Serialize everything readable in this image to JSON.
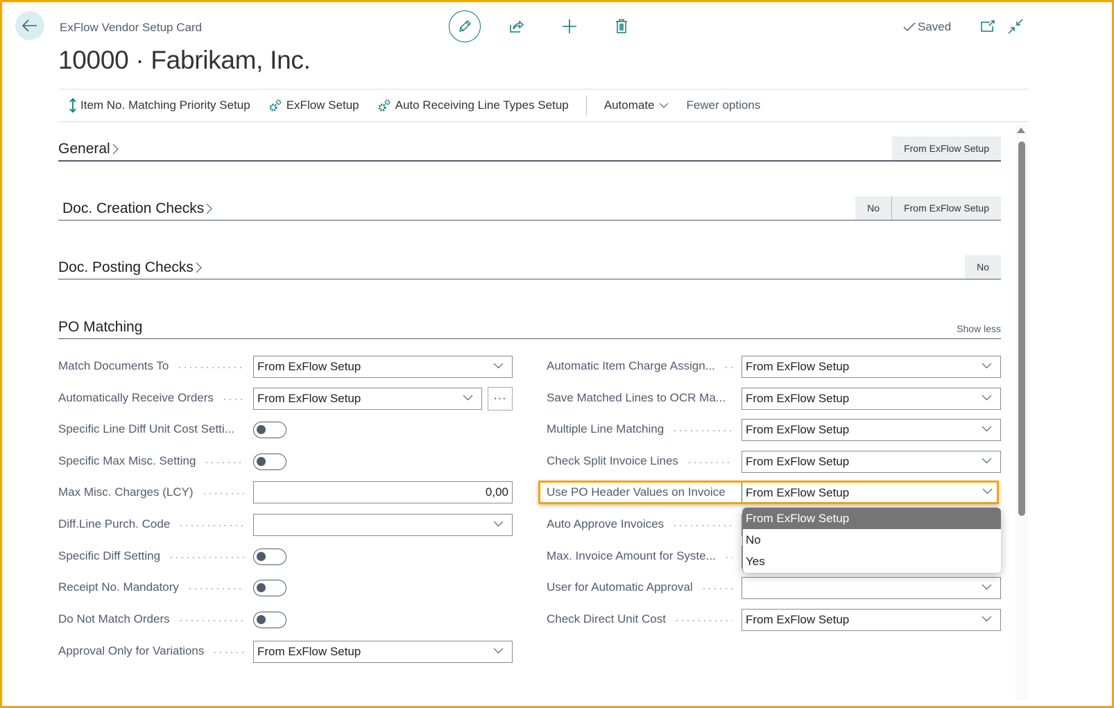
{
  "header": {
    "caption": "ExFlow Vendor Setup Card",
    "title": "10000 · Fabrikam, Inc.",
    "saved_label": "Saved",
    "icons": [
      "back-arrow-icon",
      "pencil-icon",
      "share-icon",
      "plus-icon",
      "trash-icon",
      "checkmark-icon",
      "open-new-window-icon",
      "collapse-icon"
    ]
  },
  "action_bar": {
    "actions": [
      {
        "label": "Item No. Matching Priority Setup",
        "icon": "sort-arrows-icon"
      },
      {
        "label": "ExFlow Setup",
        "icon": "gears-icon"
      },
      {
        "label": "Auto Receiving Line Types Setup",
        "icon": "gears-icon"
      }
    ],
    "automate_label": "Automate",
    "fewer_options_label": "Fewer options"
  },
  "fasttabs": {
    "general": {
      "title": "General",
      "summary": [
        "From ExFlow Setup"
      ]
    },
    "doc_creation": {
      "title": "Doc. Creation Checks",
      "summary": [
        "No",
        "From ExFlow Setup"
      ]
    },
    "doc_posting": {
      "title": "Doc. Posting Checks",
      "summary": [
        "No"
      ]
    },
    "po_matching": {
      "title": "PO Matching",
      "show_less_label": "Show less"
    }
  },
  "po_matching": {
    "left": [
      {
        "label": "Match Documents To",
        "type": "select",
        "value": "From ExFlow Setup"
      },
      {
        "label": "Automatically Receive Orders",
        "type": "select-lookup",
        "value": "From ExFlow Setup",
        "lookup_label": "···"
      },
      {
        "label": "Specific Line Diff Unit Cost Setti...",
        "type": "toggle",
        "value": false
      },
      {
        "label": "Specific Max Misc. Setting",
        "type": "toggle",
        "value": false
      },
      {
        "label": "Max Misc. Charges (LCY)",
        "type": "number",
        "value": "0,00"
      },
      {
        "label": "Diff.Line Purch. Code",
        "type": "select",
        "value": ""
      },
      {
        "label": "Specific Diff Setting",
        "type": "toggle",
        "value": false
      },
      {
        "label": "Receipt No. Mandatory",
        "type": "toggle",
        "value": false
      },
      {
        "label": "Do Not Match Orders",
        "type": "toggle",
        "value": false
      },
      {
        "label": "Approval Only for Variations",
        "type": "select",
        "value": "From ExFlow Setup"
      }
    ],
    "right": [
      {
        "label": "Automatic Item Charge Assign...",
        "type": "select",
        "value": "From ExFlow Setup"
      },
      {
        "label": "Save Matched Lines to OCR Ma...",
        "type": "select",
        "value": "From ExFlow Setup"
      },
      {
        "label": "Multiple Line Matching",
        "type": "select",
        "value": "From ExFlow Setup"
      },
      {
        "label": "Check Split Invoice Lines",
        "type": "select",
        "value": "From ExFlow Setup"
      },
      {
        "label": "Use PO Header Values on Invoice",
        "type": "select",
        "value": "From ExFlow Setup"
      },
      {
        "label": "Auto Approve Invoices",
        "type": "select",
        "value": ""
      },
      {
        "label": "Max. Invoice Amount for Syste...",
        "type": "select",
        "value": ""
      },
      {
        "label": "User for Automatic Approval",
        "type": "select",
        "value": ""
      },
      {
        "label": "Check Direct Unit Cost",
        "type": "select",
        "value": "From ExFlow Setup"
      }
    ]
  },
  "dropdown": {
    "options": [
      "From ExFlow Setup",
      "No",
      "Yes"
    ],
    "selected": "From ExFlow Setup"
  },
  "colors": {
    "accent": "#0f7b7f",
    "highlight": "#f5a500",
    "selected_option_bg": "#757575"
  }
}
